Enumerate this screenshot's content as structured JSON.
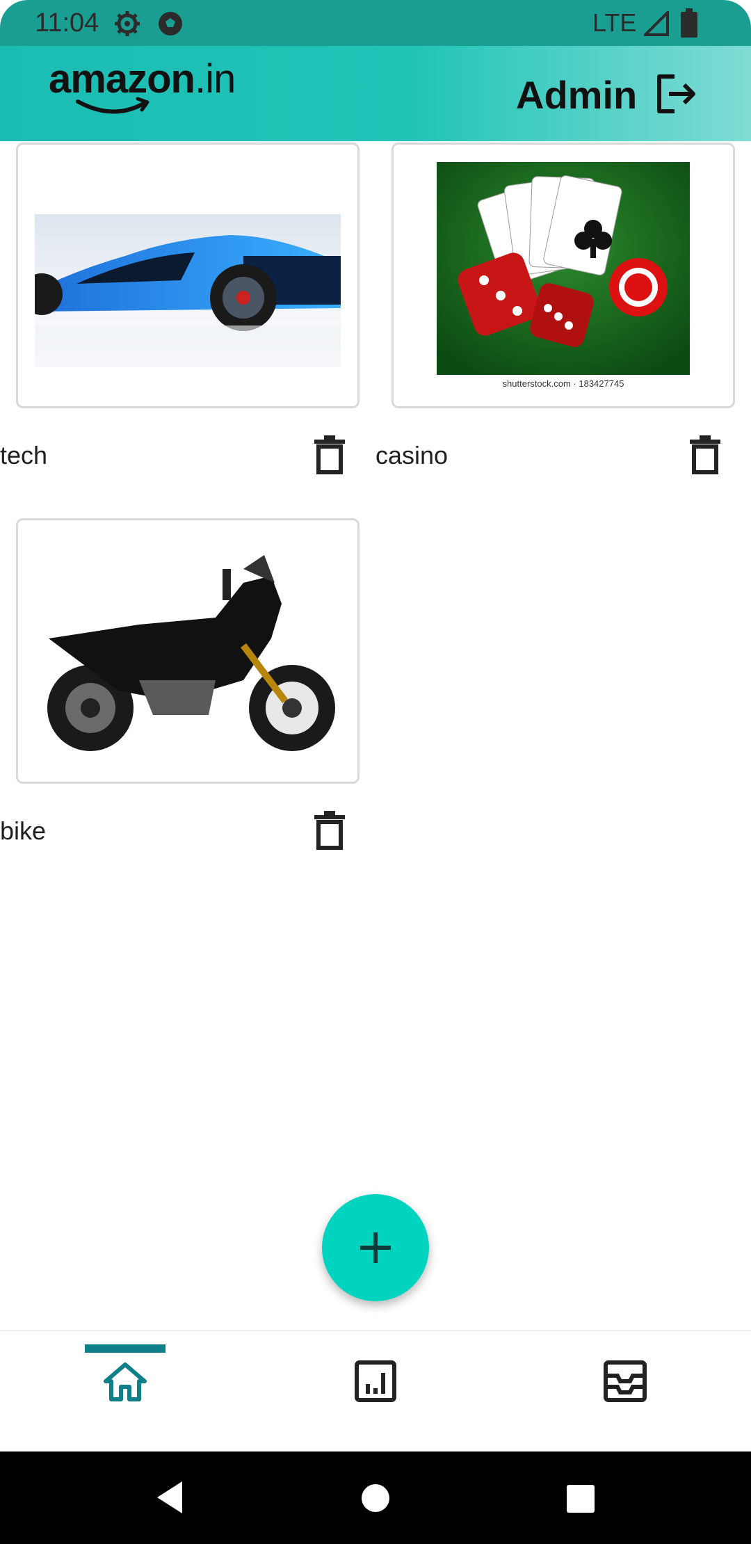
{
  "status_bar": {
    "time": "11:04",
    "network": "LTE",
    "icons": [
      "settings-gear-icon",
      "soccer-ball-icon",
      "signal-icon",
      "battery-icon"
    ]
  },
  "app_bar": {
    "logo_text": "amazon",
    "logo_domain": ".in",
    "user_label": "Admin",
    "logout_icon": "logout-icon"
  },
  "categories": [
    {
      "label": "tech",
      "image": "blue-sports-car"
    },
    {
      "label": "casino",
      "image": "playing-cards-and-dice",
      "image_caption": "shutterstock.com · 183427745"
    },
    {
      "label": "bike",
      "image": "black-motorcycle"
    }
  ],
  "fab": {
    "icon": "plus-icon"
  },
  "bottom_nav": {
    "items": [
      {
        "icon": "home-icon",
        "active": true
      },
      {
        "icon": "analytics-icon",
        "active": false
      },
      {
        "icon": "orders-inbox-icon",
        "active": false
      }
    ],
    "active_color": "#0f7f8a"
  },
  "colors": {
    "app_bar": "#22c4b8",
    "status_bar": "#1a9e92",
    "fab": "#00d4be"
  }
}
